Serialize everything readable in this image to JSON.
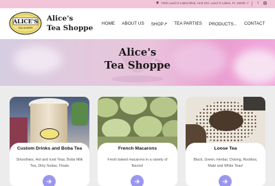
{
  "topbar": {
    "address": "7000 Land O Lakes Blvd. Unit 102, Land O Lakes, FL 34639",
    "social": [
      "facebook-icon",
      "instagram-icon"
    ]
  },
  "header": {
    "logo_text": "ALICE'S",
    "logo_sub": "TEA SHOPPE",
    "brand_line1": "Alice's",
    "brand_line2": "Tea Shoppe",
    "nav": [
      {
        "label": "HOME"
      },
      {
        "label": "ABOUT US"
      },
      {
        "label": "SHOP"
      },
      {
        "label": "TEA PARTIES"
      },
      {
        "label": "PRODUCTS"
      },
      {
        "label": "CONTACT"
      }
    ]
  },
  "hero": {
    "line1": "Alice's",
    "line2": "Tea Shoppe"
  },
  "cards": [
    {
      "title": "Custom Drinks and Boba Tea",
      "desc": "Smoothies, Hot and Iced Teas, Boba Milk Tea, Dirty Sodas, Floats"
    },
    {
      "title": "French Macarons",
      "desc": "Fresh baked macarons in a variety of flavors!"
    },
    {
      "title": "Loose Tea",
      "desc": "Black, Green, Herbal, Oolong, Rooibos, Maté and White Teas!"
    }
  ],
  "colors": {
    "topbar": "#f1c4d8",
    "accent_button": "#9b96ee",
    "logo_yellow": "#f3e27a"
  }
}
